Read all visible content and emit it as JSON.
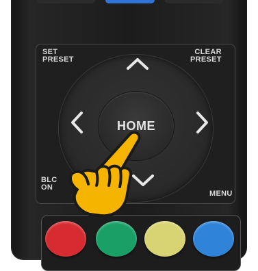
{
  "remote": {
    "labels": {
      "set_preset": "SET\nPRESET",
      "clear_preset": "CLEAR\nPRESET",
      "home": "HOME",
      "blc_on": "BLC\nON",
      "menu": "MENU"
    },
    "colors": {
      "red": "#d62b30",
      "green": "#1aa067",
      "yellow": "#d8d373",
      "blue": "#2f83d8",
      "top_blue": "#2f74d9",
      "hand": "#f5b400"
    },
    "icons": [
      "chevron-up-icon",
      "chevron-left-icon",
      "chevron-right-icon",
      "chevron-down-icon",
      "pointing-hand-icon"
    ]
  }
}
